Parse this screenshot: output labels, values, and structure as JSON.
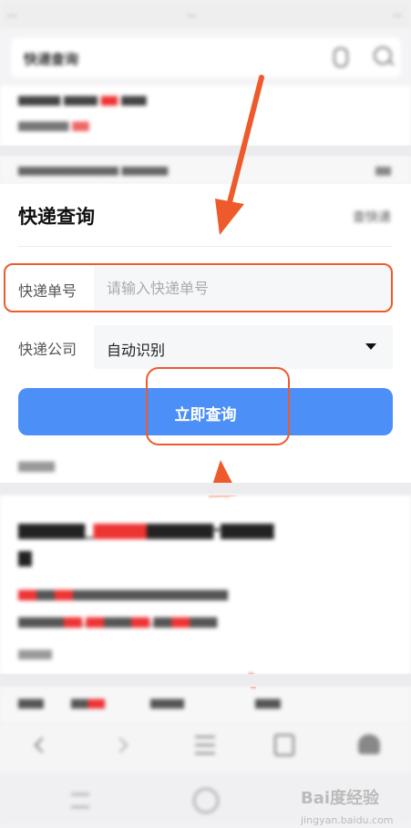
{
  "status_bar": {
    "left": "...",
    "center": "...",
    "right": "..."
  },
  "search": {
    "query": "快递查询"
  },
  "express_query": {
    "title": "快递查询",
    "source": "查快递",
    "number_label": "快递单号",
    "number_placeholder": "请输入快递单号",
    "company_label": "快递公司",
    "company_value": "自动识别",
    "submit_label": "立即查询"
  },
  "watermark": {
    "text": "Bai度经验",
    "sub": "jingyan.baidu.com"
  },
  "annotation_color": "#ee5a2b",
  "button_color": "#4c8ff7"
}
